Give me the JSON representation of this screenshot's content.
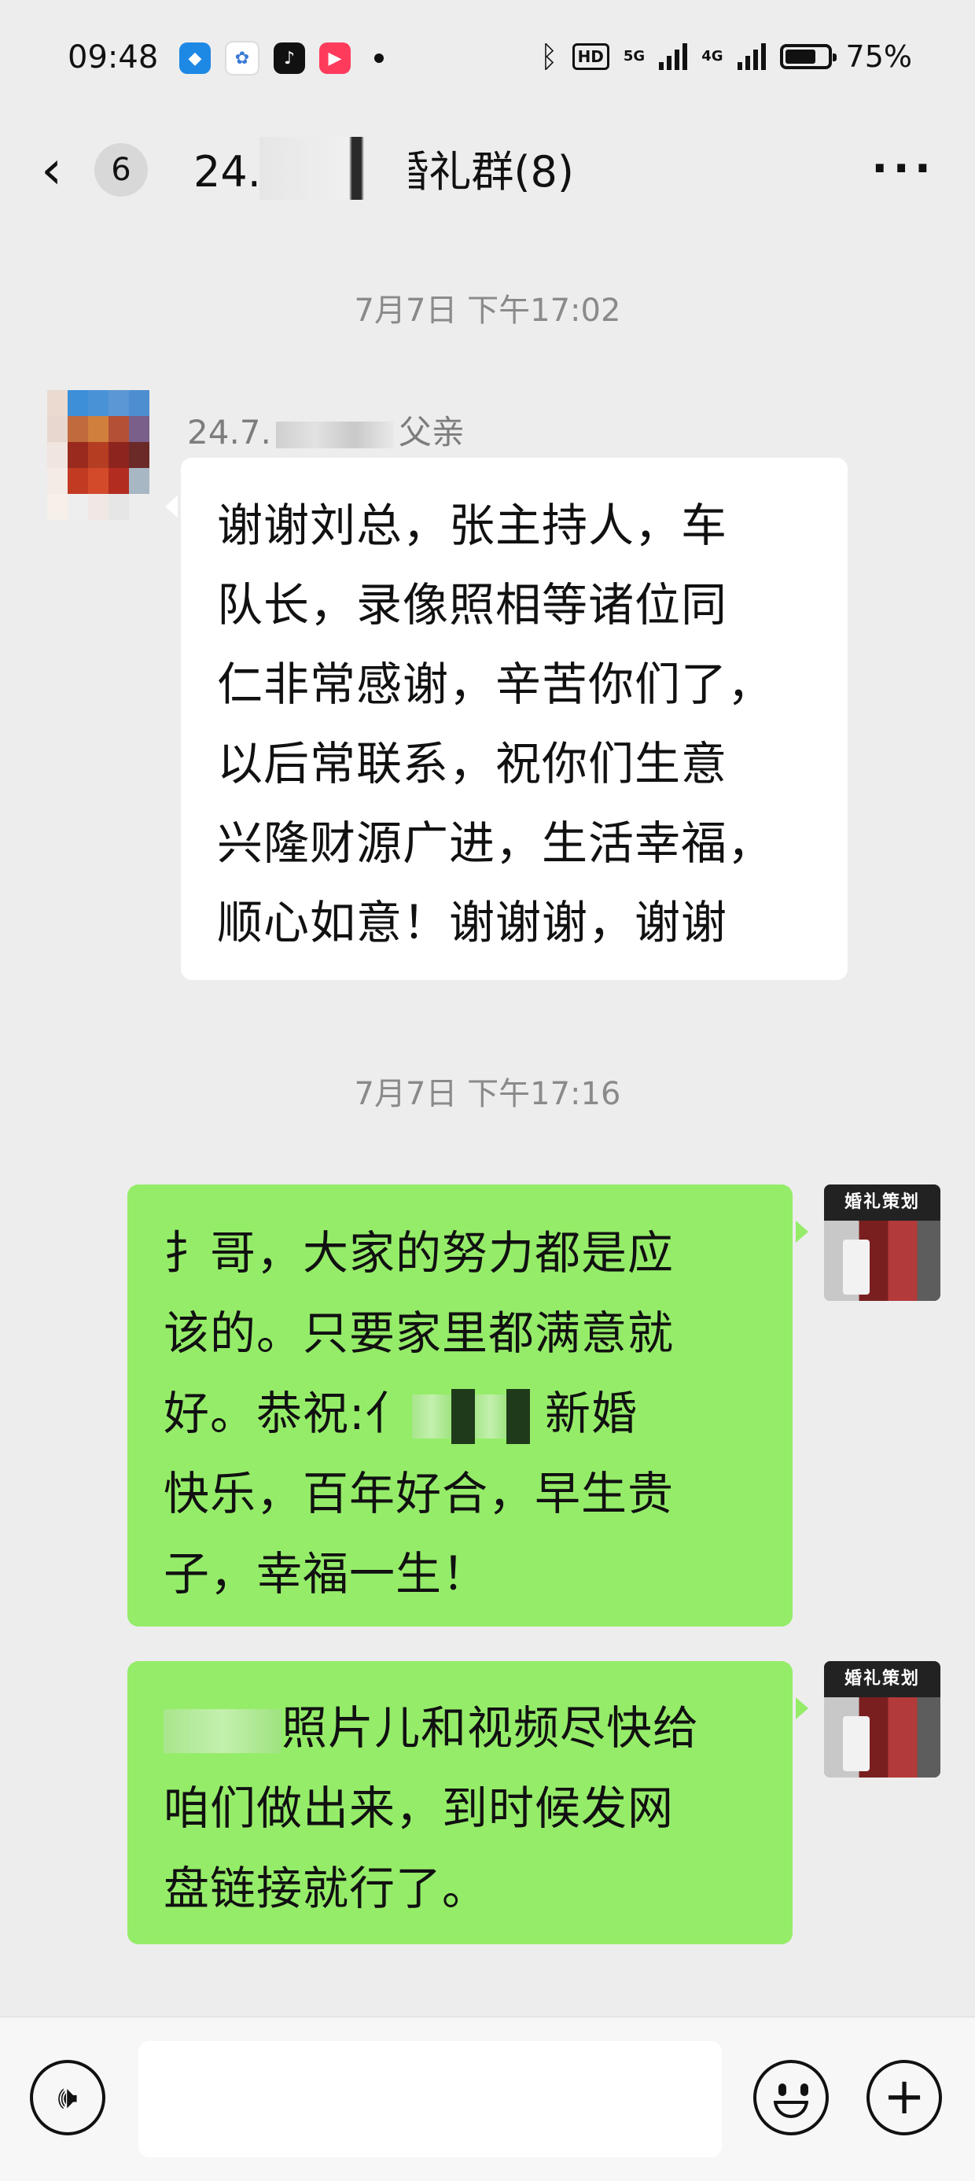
{
  "status_bar": {
    "time": "09:48",
    "app_icons": [
      "browser-icon",
      "cloud-icon",
      "tiktok-icon",
      "kuaishou-icon"
    ],
    "net1": "5G",
    "net2": "4G",
    "hd_label": "HD",
    "battery_percent": "75%",
    "battery_level": 0.75
  },
  "nav": {
    "back_count": "6",
    "title": "24.7      达…婚礼群(8)",
    "more": "···"
  },
  "messages": [
    {
      "timestamp": "7月7日 下午17:02",
      "sender": "24.7.",
      "sender_suffix": "父亲",
      "lines": [
        "谢谢刘总，张主持人，车",
        "队长，录像照相等诸位同",
        "仁非常感谢，辛苦你们了，",
        "以后常联系，祝你们生意",
        "兴隆财源广进，生活幸福，",
        "顺心如意！谢谢谢，谢谢"
      ]
    },
    {
      "timestamp": "7月7日 下午17:16",
      "line1_start": "扌",
      "line1_rest": "哥，大家的努力都是应",
      "line2": "该的。只要家里都满意就",
      "line3_start": "好。恭祝:亻",
      "line3_end": "新婚",
      "line4": "快乐，百年好合，早生贵",
      "line5": "子，幸福一生！"
    },
    {
      "line1_rest": "照片儿和视频尽快给",
      "line2": "咱们做出来，到时候发网",
      "line3": "盘链接就行了。"
    }
  ],
  "avatar_sign": "婚礼策划",
  "input": {
    "placeholder": ""
  },
  "colors": {
    "bubble_self": "#95ec69",
    "bubble_other": "#ffffff",
    "background": "#ededed"
  }
}
